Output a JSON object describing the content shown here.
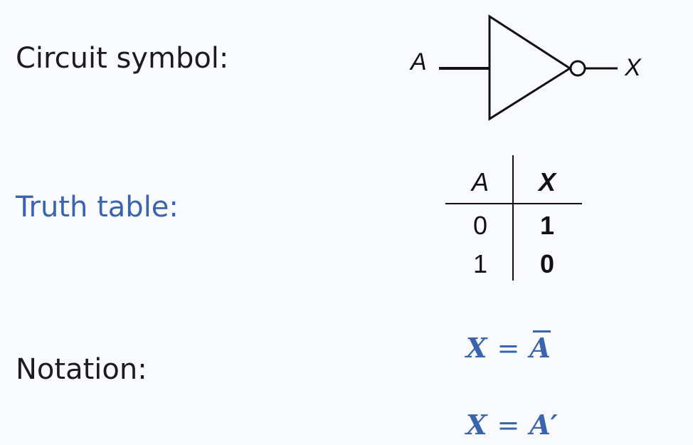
{
  "labels": {
    "circuit_symbol": "Circuit symbol:",
    "truth_table": "Truth table:",
    "notation": "Notation:"
  },
  "gate": {
    "input_label": "A",
    "output_label": "X"
  },
  "truth_table": {
    "headers": [
      "A",
      "X"
    ],
    "rows": [
      [
        "0",
        "1"
      ],
      [
        "1",
        "0"
      ]
    ]
  },
  "notation": {
    "eq1": {
      "lhs": "X",
      "op": "=",
      "rhs": "A"
    },
    "eq2": {
      "lhs": "X",
      "op": "=",
      "rhs": "A′"
    }
  },
  "colors": {
    "accent": "#3a64ad",
    "text": "#1c1c1c",
    "background": "#f8fafe"
  }
}
